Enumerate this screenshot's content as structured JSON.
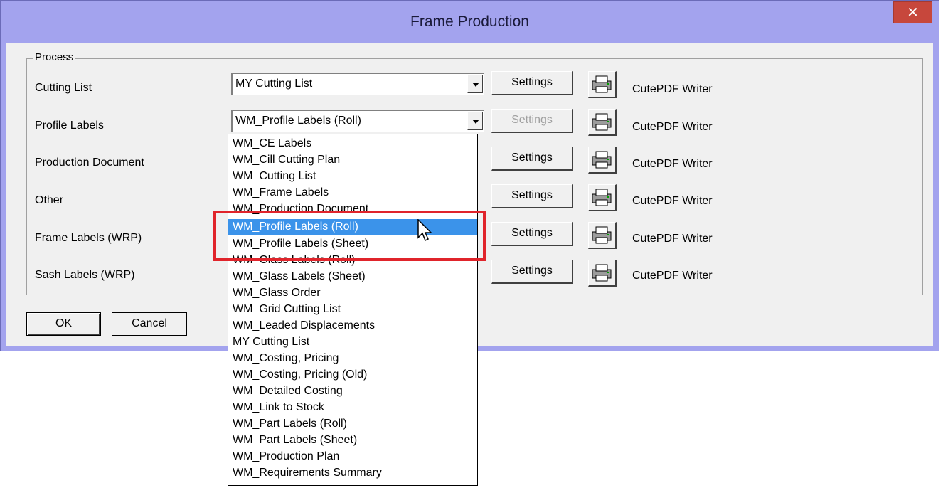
{
  "window": {
    "title": "Frame Production",
    "close_glyph": "✕"
  },
  "process": {
    "legend": "Process",
    "rows": [
      {
        "label": "Cutting List",
        "combo_value": "MY Cutting List",
        "settings_label": "Settings",
        "printer": "CutePDF Writer"
      },
      {
        "label": "Profile Labels",
        "combo_value": "WM_Profile Labels (Roll)",
        "settings_label": "Settings",
        "printer": "CutePDF Writer"
      },
      {
        "label": "Production Document",
        "settings_label": "Settings",
        "printer": "CutePDF Writer"
      },
      {
        "label": "Other",
        "settings_label": "Settings",
        "printer": "CutePDF Writer"
      },
      {
        "label": "Frame Labels (WRP)",
        "settings_label": "Settings",
        "printer": "CutePDF Writer"
      },
      {
        "label": "Sash Labels (WRP)",
        "settings_label": "Settings",
        "printer": "CutePDF Writer"
      }
    ]
  },
  "buttons": {
    "ok": "OK",
    "cancel": "Cancel"
  },
  "dropdown": {
    "selected": "WM_Profile Labels (Roll)",
    "options": [
      "WM_CE Labels",
      "WM_Cill Cutting Plan",
      "WM_Cutting List",
      "WM_Frame Labels",
      "WM_Production Document",
      "WM_Profile Labels (Roll)",
      "WM_Profile Labels (Sheet)",
      "WM_Glass Labels (Roll)",
      "WM_Glass Labels (Sheet)",
      "WM_Glass Order",
      "WM_Grid Cutting List",
      "WM_Leaded Displacements",
      "MY Cutting List",
      "WM_Costing, Pricing",
      "WM_Costing, Pricing (Old)",
      "WM_Detailed Costing",
      "WM_Link to Stock",
      "WM_Part Labels (Roll)",
      "WM_Part Labels (Sheet)",
      "WM_Production Plan",
      "WM_Requirements Summary"
    ]
  },
  "colors": {
    "selection": "#3b93ea",
    "highlight": "#e0242b",
    "titlebar": "#a3a3ee",
    "close": "#c7473c"
  },
  "icons": {
    "printer": "printer-icon",
    "cursor": "arrow-cursor-icon"
  }
}
